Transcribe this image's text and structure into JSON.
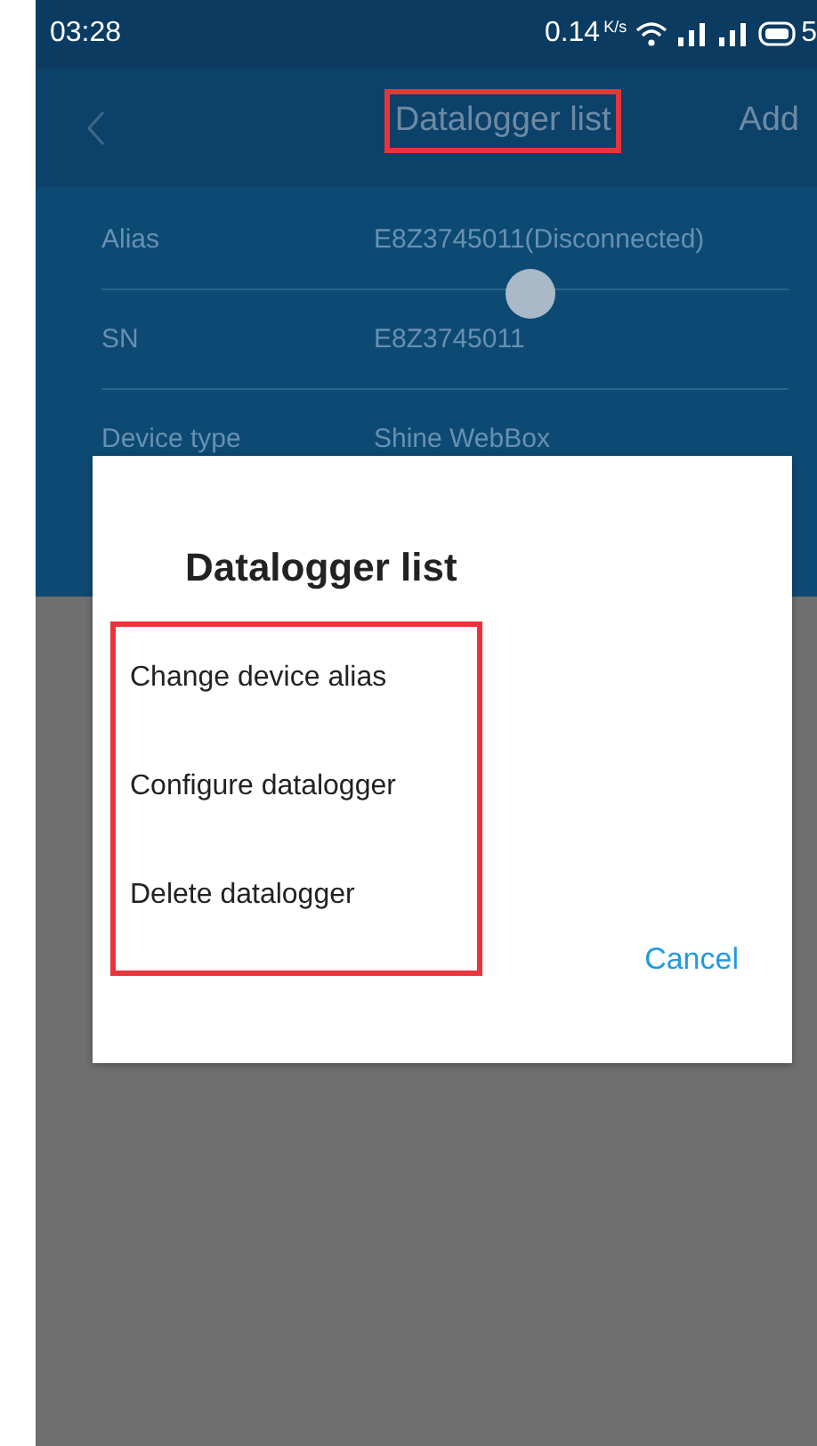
{
  "status_bar": {
    "time": "03:28",
    "speed": "0.14",
    "speed_unit": "K/s",
    "battery": "5"
  },
  "app_bar": {
    "title": "Datalogger list",
    "action": "Add"
  },
  "details": [
    {
      "label": "Alias",
      "value": "E8Z3745011(Disconnected)"
    },
    {
      "label": "SN",
      "value": "E8Z3745011"
    },
    {
      "label": "Device type",
      "value": "Shine WebBox"
    }
  ],
  "dialog": {
    "title": "Datalogger list",
    "options": [
      "Change device alias",
      "Configure datalogger",
      "Delete datalogger"
    ],
    "cancel": "Cancel"
  }
}
